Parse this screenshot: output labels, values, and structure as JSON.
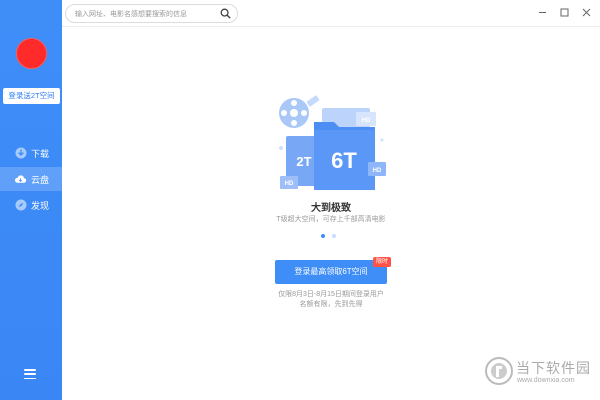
{
  "sidebar": {
    "login_label": "登录送2T空间",
    "items": [
      {
        "label": "下载",
        "icon": "download-icon",
        "active": false
      },
      {
        "label": "云盘",
        "icon": "cloud-icon",
        "active": true
      },
      {
        "label": "发现",
        "icon": "compass-icon",
        "active": false
      }
    ],
    "menu_icon": "menu-icon"
  },
  "topbar": {
    "search_placeholder": "输入网址、电影名感想要搜索的信息",
    "search_icon": "search-icon",
    "controls": [
      "minimize-icon",
      "maximize-icon",
      "close-icon"
    ]
  },
  "main": {
    "illustration": {
      "small_label": "2T",
      "big_label": "6T",
      "hd_label": "HD"
    },
    "title": "大到极致",
    "subtitle": "T级超大空间，可存上千部高清电影",
    "carousel": {
      "count": 2,
      "active_index": 0
    },
    "cta_label": "登录最高领取6T空间",
    "cta_badge": "限时",
    "note_line1": "仅限8月3日-8月15日期间登录用户",
    "note_line2": "名额有限，先到先得"
  },
  "watermark": {
    "text": "当下软件园",
    "url": "www.downxia.com"
  },
  "colors": {
    "accent": "#3f8ef8",
    "avatar": "#ff2a2a",
    "badge": "#ff5247"
  }
}
